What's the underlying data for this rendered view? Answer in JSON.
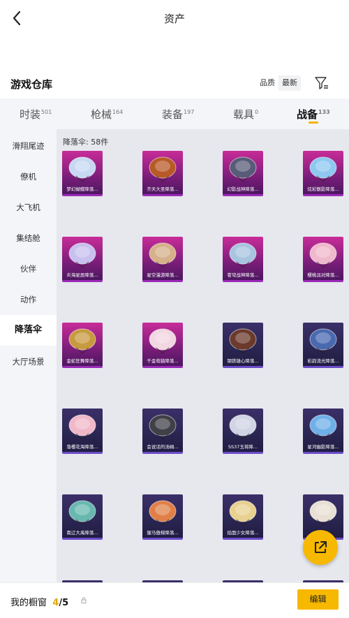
{
  "header": {
    "title": "资产"
  },
  "warehouse": {
    "title": "游戏仓库",
    "sort": [
      "品质",
      "最新"
    ]
  },
  "tabs": [
    {
      "label": "时装",
      "count": "501"
    },
    {
      "label": "枪械",
      "count": "164"
    },
    {
      "label": "装备",
      "count": "197"
    },
    {
      "label": "载具",
      "count": "0"
    },
    {
      "label": "战备",
      "count": "133",
      "active": true
    }
  ],
  "sidebar": [
    "滑翔尾迹",
    "僚机",
    "大飞机",
    "集结舱",
    "伙伴",
    "动作",
    "降落伞",
    "大厅场景"
  ],
  "sidebar_active": "降落伞",
  "content": {
    "count_label": "降落伞: 58件"
  },
  "items": [
    {
      "name": "梦幻蝴蝶降落...",
      "tier": "legend",
      "color": "#c8d8f2"
    },
    {
      "name": "齐天大圣降落...",
      "tier": "legend",
      "color": "#b85a28"
    },
    {
      "name": "幻影战神降落...",
      "tier": "legend",
      "color": "#585c78"
    },
    {
      "name": "炫彩魅影降落...",
      "tier": "legend",
      "color": "#8ec8f0"
    },
    {
      "name": "炎海星辰降落...",
      "tier": "legend",
      "color": "#c8c0ee"
    },
    {
      "name": "星空漫游降落...",
      "tier": "legend",
      "color": "#d6b08a"
    },
    {
      "name": "苍穹战神降落...",
      "tier": "legend",
      "color": "#a8c4e0"
    },
    {
      "name": "樱桃派对降落...",
      "tier": "legend",
      "color": "#f0b8cc"
    },
    {
      "name": "金蛇狂舞降落...",
      "tier": "legend",
      "color": "#c89a40"
    },
    {
      "name": "千金萌猫降落...",
      "tier": "legend",
      "color": "#f2d6e2"
    },
    {
      "name": "钢铁雄心降落...",
      "tier": "epic",
      "color": "#6b3a2c"
    },
    {
      "name": "彩韵流光降落...",
      "tier": "epic",
      "color": "#4a6ab0"
    },
    {
      "name": "落樱花海降落...",
      "tier": "epic",
      "color": "#f0b8c8"
    },
    {
      "name": "会说话的汤姆...",
      "tier": "epic",
      "color": "#404048"
    },
    {
      "name": "SS37玉将降...",
      "tier": "epic",
      "color": "#d0d4e4"
    },
    {
      "name": "星河幽影降落...",
      "tier": "epic",
      "color": "#70b0e8"
    },
    {
      "name": "南辽大禹降落...",
      "tier": "epic",
      "color": "#68b8b0"
    },
    {
      "name": "猩马傲梯降落...",
      "tier": "epic",
      "color": "#e08048"
    },
    {
      "name": "焰面少女降落...",
      "tier": "epic",
      "color": "#e8d090"
    },
    {
      "name": "",
      "tier": "epic",
      "color": "#e8e0d4"
    },
    {
      "name": "",
      "tier": "epic",
      "color": "#5a5a70"
    },
    {
      "name": "",
      "tier": "epic",
      "color": "#5a5a70"
    },
    {
      "name": "",
      "tier": "epic",
      "color": "#5a5a70"
    },
    {
      "name": "",
      "tier": "epic",
      "color": "#5a5a70"
    }
  ],
  "footer": {
    "label": "我的橱窗",
    "current": "4",
    "total": "/5",
    "edit": "编辑"
  },
  "colors": {
    "accent": "#f7b800",
    "legend": "#c82c98",
    "epic": "#3b2f68"
  }
}
